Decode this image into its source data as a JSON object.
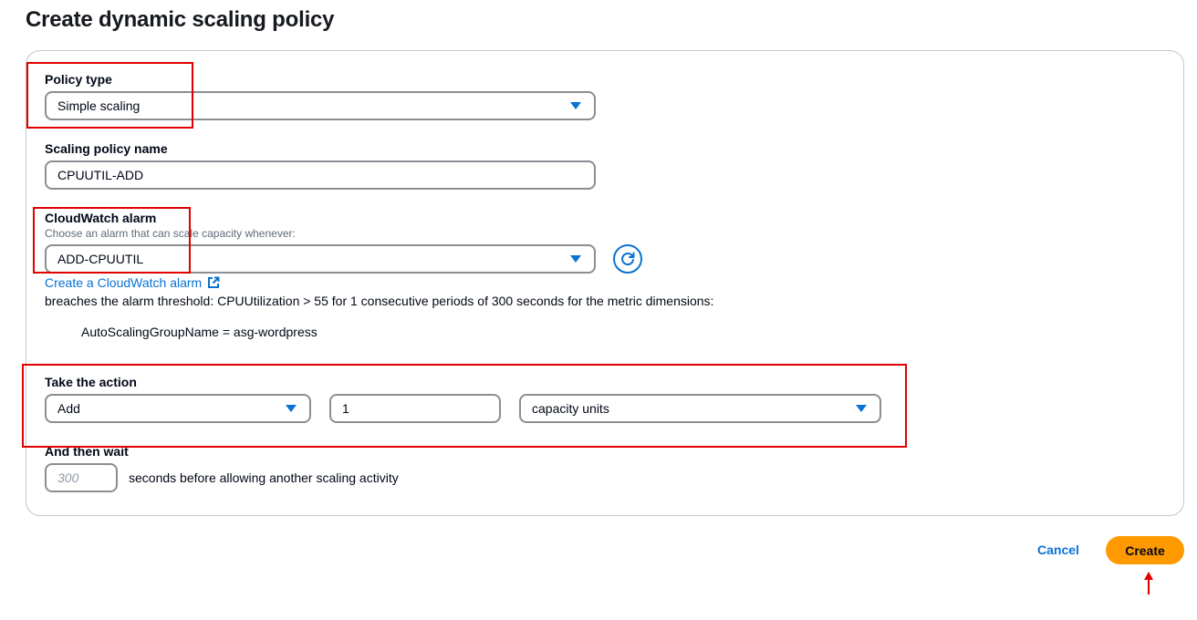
{
  "page": {
    "title": "Create dynamic scaling policy"
  },
  "policy_type": {
    "label": "Policy type",
    "value": "Simple scaling"
  },
  "policy_name": {
    "label": "Scaling policy name",
    "value": "CPUUTIL-ADD"
  },
  "alarm": {
    "label": "CloudWatch alarm",
    "description": "Choose an alarm that can scale capacity whenever:",
    "value": "ADD-CPUUTIL",
    "create_link": "Create a CloudWatch alarm",
    "breach_text": "breaches the alarm threshold: CPUUtilization > 55 for 1 consecutive periods of 300 seconds for the metric dimensions:",
    "dimension": "AutoScalingGroupName = asg-wordpress"
  },
  "action": {
    "label": "Take the action",
    "operation": "Add",
    "amount": "1",
    "unit": "capacity units"
  },
  "wait": {
    "label": "And then wait",
    "placeholder": "300",
    "suffix": "seconds before allowing another scaling activity"
  },
  "buttons": {
    "cancel": "Cancel",
    "create": "Create"
  },
  "colors": {
    "accent": "#0972d3",
    "primary_button": "#ff9900",
    "annotation": "#e00000"
  },
  "icons": [
    "caret-down-icon",
    "refresh-icon",
    "external-link-icon",
    "annotation-arrow-icon"
  ]
}
